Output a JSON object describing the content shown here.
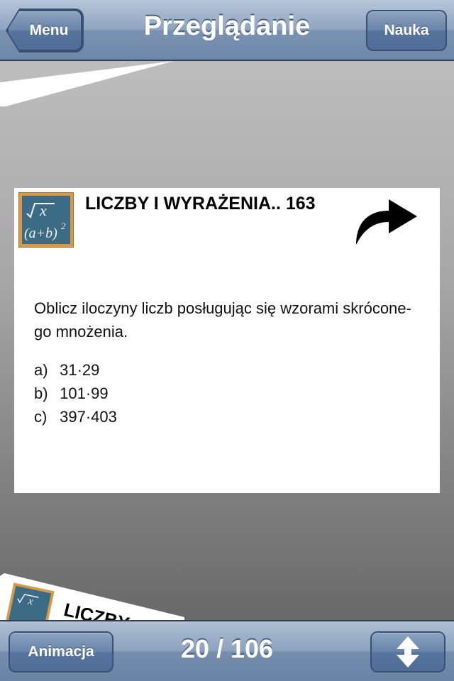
{
  "nav": {
    "title": "Przeglądanie",
    "back_label": "Menu",
    "right_label": "Nauka"
  },
  "card": {
    "title": "LICZBY I WYRAŻENIA.. 163",
    "task": "Oblicz iloczyny liczb posługując się wzorami skrócone-go mnożenia.",
    "items": [
      {
        "label": "a)",
        "expr": "31·29"
      },
      {
        "label": "b)",
        "expr": "101·99"
      },
      {
        "label": "c)",
        "expr": "397·403"
      }
    ],
    "board_icon": "chalkboard-math-icon",
    "next_icon": "curved-arrow-right-icon"
  },
  "bg_card": {
    "title": "LICZBY"
  },
  "toolbar": {
    "animation_label": "Animacja",
    "counter": "20 / 106",
    "sort_icon": "up-down-arrows-icon"
  },
  "colors": {
    "navbar": "#7a92b2",
    "button": "#56749d",
    "chalkboard": "#3c6b85",
    "board_frame": "#d59a45"
  }
}
